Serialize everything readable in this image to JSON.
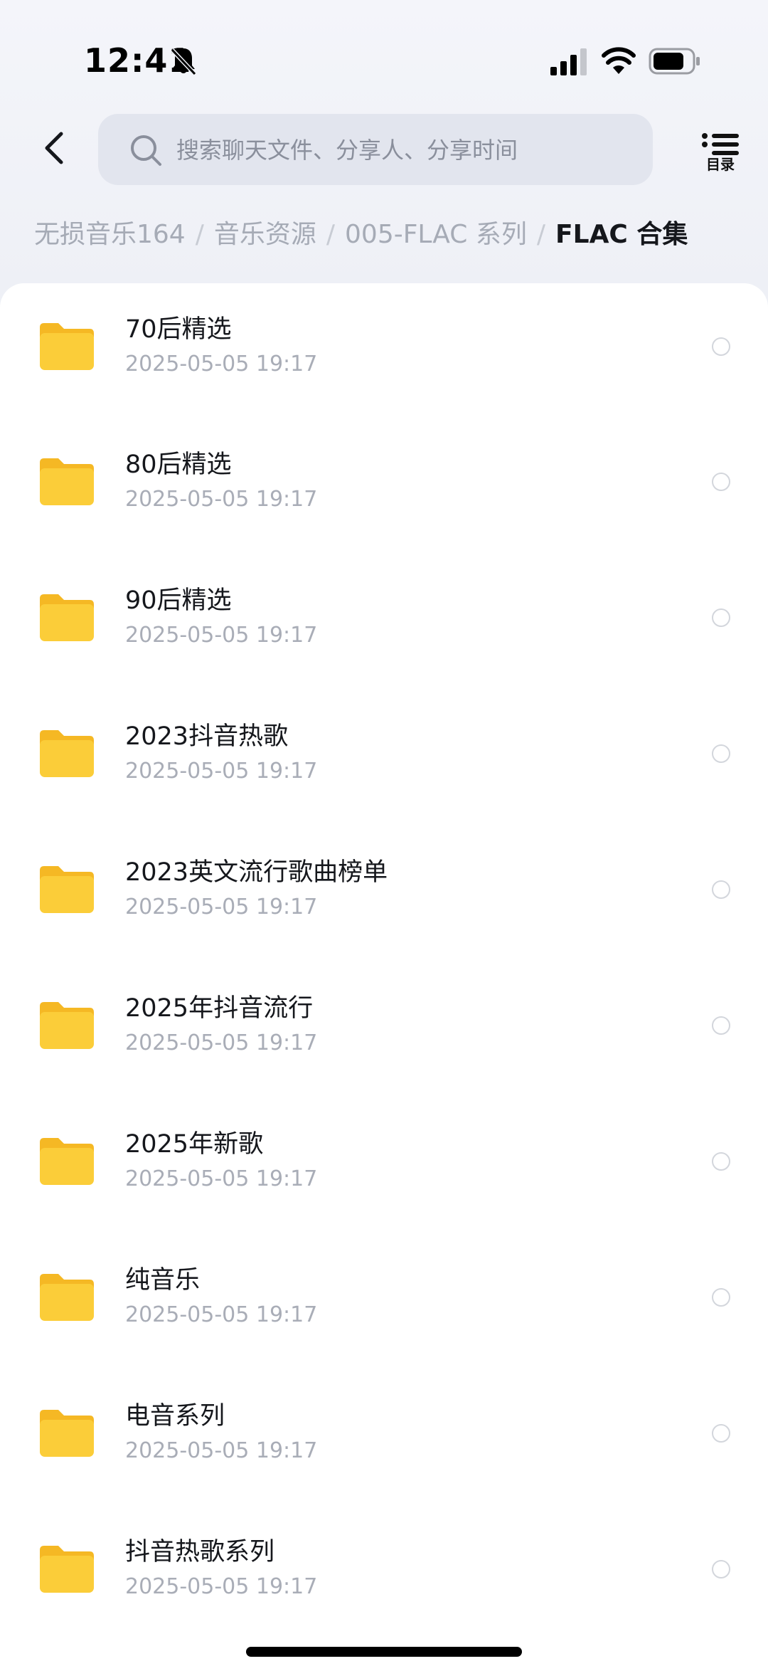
{
  "status_bar": {
    "time": "12:41"
  },
  "header": {
    "search_placeholder": "搜索聊天文件、分享人、分享时间",
    "toc_label": "目录"
  },
  "breadcrumb": {
    "items": [
      "无损音乐164",
      "音乐资源",
      "005-FLAC 系列"
    ],
    "current": "FLAC 合集",
    "separator": "/"
  },
  "folders": [
    {
      "name": "70后精选",
      "time": "2025-05-05 19:17"
    },
    {
      "name": "80后精选",
      "time": "2025-05-05 19:17"
    },
    {
      "name": "90后精选",
      "time": "2025-05-05 19:17"
    },
    {
      "name": "2023抖音热歌",
      "time": "2025-05-05 19:17"
    },
    {
      "name": "2023英文流行歌曲榜单",
      "time": "2025-05-05 19:17"
    },
    {
      "name": "2025年抖音流行",
      "time": "2025-05-05 19:17"
    },
    {
      "name": "2025年新歌",
      "time": "2025-05-05 19:17"
    },
    {
      "name": "纯音乐",
      "time": "2025-05-05 19:17"
    },
    {
      "name": "电音系列",
      "time": "2025-05-05 19:17"
    },
    {
      "name": "抖音热歌系列",
      "time": "2025-05-05 19:17"
    }
  ],
  "colors": {
    "folder": "#fbcd39",
    "folder_tab": "#f5b824",
    "accent_text": "#15171c",
    "muted_text": "#a9adb7"
  }
}
